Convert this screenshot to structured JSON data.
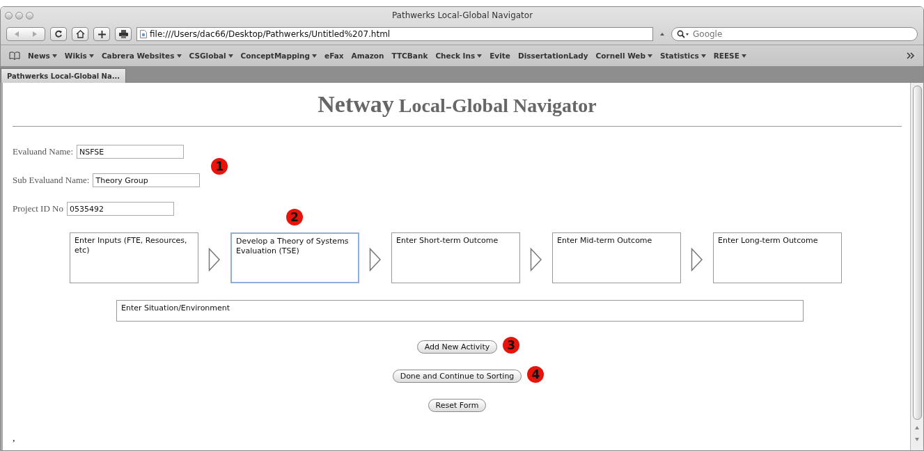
{
  "window": {
    "title": "Pathwerks Local-Global Navigator"
  },
  "toolbar": {
    "address": "file:///Users/dac66/Desktop/Pathwerks/Untitled%207.html",
    "search": {
      "placeholder": "Google"
    }
  },
  "bookmarks": [
    {
      "label": "News",
      "menu": true
    },
    {
      "label": "Wikis",
      "menu": true
    },
    {
      "label": "Cabrera Websites",
      "menu": true
    },
    {
      "label": "CSGlobal",
      "menu": true
    },
    {
      "label": "ConceptMapping",
      "menu": true
    },
    {
      "label": "eFax",
      "menu": false
    },
    {
      "label": "Amazon",
      "menu": false
    },
    {
      "label": "TTCBank",
      "menu": false
    },
    {
      "label": "Check Ins",
      "menu": true
    },
    {
      "label": "Evite",
      "menu": false
    },
    {
      "label": "DissertationLady",
      "menu": false
    },
    {
      "label": "Cornell Web",
      "menu": true
    },
    {
      "label": "Statistics",
      "menu": true
    },
    {
      "label": "REESE",
      "menu": true
    }
  ],
  "tabs": [
    {
      "label": "Pathwerks Local-Global Na...",
      "selected": true
    }
  ],
  "page": {
    "heading_first": "Netway",
    "heading_rest": "Local-Global Navigator",
    "fields": [
      {
        "label": "Evaluand Name:",
        "value": "NSFSE"
      },
      {
        "label": "Sub Evaluand Name:",
        "value": "Theory Group",
        "badge": "1"
      },
      {
        "label": "Project ID No",
        "value": "0535492"
      }
    ],
    "steps": [
      {
        "value": "Enter Inputs (FTE, Resources, etc)",
        "focused": false
      },
      {
        "value": "Develop a Theory of Systems Evaluation (TSE)",
        "focused": true,
        "badge": "2"
      },
      {
        "value": "Enter Short-term Outcome",
        "focused": false
      },
      {
        "value": "Enter Mid-term Outcome",
        "focused": false
      },
      {
        "value": "Enter Long-term Outcome",
        "focused": false
      }
    ],
    "situation": "Enter Situation/Environment",
    "buttons": [
      {
        "label": "Add New Activity",
        "badge": "3"
      },
      {
        "label": "Done and Continue to Sorting",
        "badge": "4"
      },
      {
        "label": "Reset Form"
      }
    ],
    "footer_text": ","
  }
}
